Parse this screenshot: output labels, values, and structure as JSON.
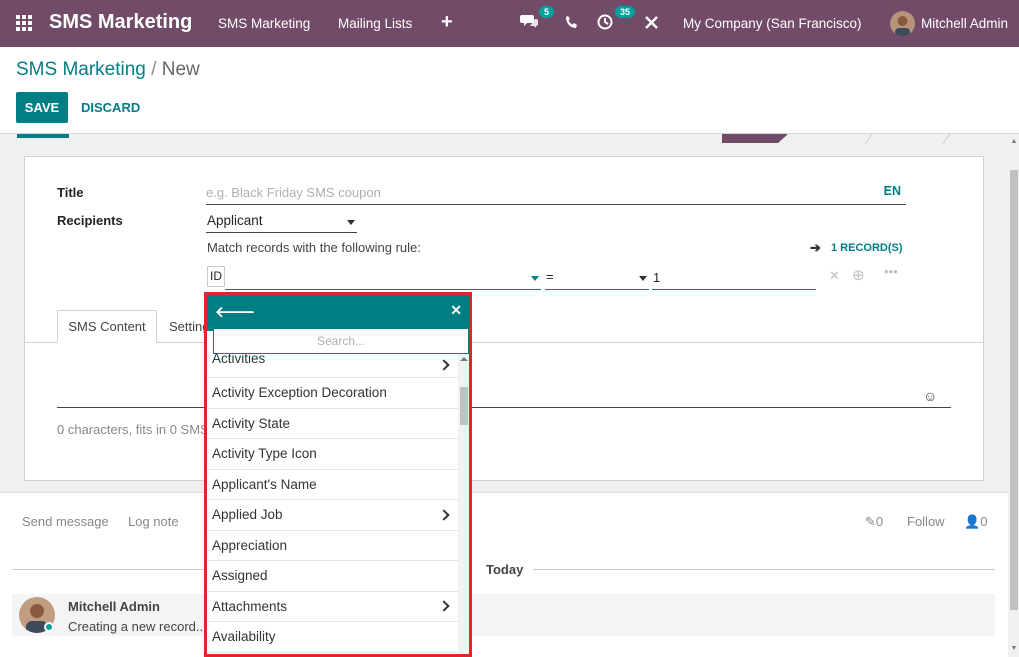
{
  "navbar": {
    "app_title": "SMS Marketing",
    "menu": [
      "SMS Marketing",
      "Mailing Lists"
    ],
    "add_icon": "+",
    "messages_count": "5",
    "activities_count": "35",
    "company": "My Company (San Francisco)",
    "user": "Mitchell Admin"
  },
  "control_panel": {
    "breadcrumb_parent": "SMS Marketing",
    "breadcrumb_sep": "/",
    "breadcrumb_current": "New",
    "save_label": "SAVE",
    "discard_label": "DISCARD"
  },
  "form": {
    "title_label": "Title",
    "title_placeholder": "e.g. Black Friday SMS coupon",
    "lang": "EN",
    "recipients_label": "Recipients",
    "recipients_value": "Applicant",
    "match_text": "Match records with the following rule:",
    "records_link": "1 RECORD(S)",
    "rule_field": "ID",
    "rule_operator": "=",
    "rule_value": "1",
    "tabs": [
      "SMS Content",
      "Settings"
    ],
    "tab_other_visible": "Setting",
    "char_count": "0 characters, fits in 0 SMS"
  },
  "field_selector": {
    "search_placeholder": "Search...",
    "items": [
      {
        "label": "Activities",
        "has_children": true
      },
      {
        "label": "Activity Exception Decoration",
        "has_children": false
      },
      {
        "label": "Activity State",
        "has_children": false
      },
      {
        "label": "Activity Type Icon",
        "has_children": false
      },
      {
        "label": "Applicant's Name",
        "has_children": false
      },
      {
        "label": "Applied Job",
        "has_children": true
      },
      {
        "label": "Appreciation",
        "has_children": false
      },
      {
        "label": "Assigned",
        "has_children": false
      },
      {
        "label": "Attachments",
        "has_children": true
      },
      {
        "label": "Availability",
        "has_children": false
      }
    ]
  },
  "chatter": {
    "send_message": "Send message",
    "log_note": "Log note",
    "attachments_count": "0",
    "follow": "Follow",
    "followers_count": "0",
    "today": "Today",
    "message_author": "Mitchell Admin",
    "message_body": "Creating a new record..."
  },
  "colors": {
    "brand": "#714b67",
    "accent": "#017e84",
    "highlight_border": "#e0252b"
  }
}
